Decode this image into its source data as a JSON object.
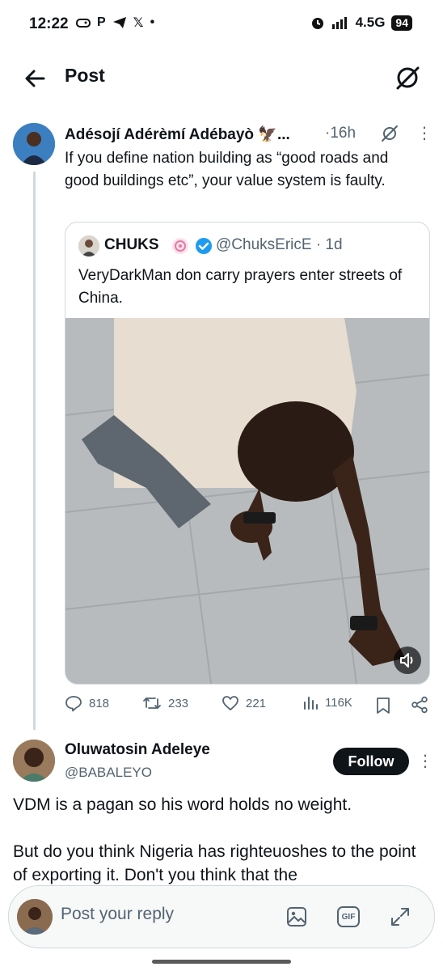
{
  "status_bar": {
    "time": "12:22",
    "network": "4.5G",
    "battery": "94"
  },
  "header": {
    "title": "Post"
  },
  "post": {
    "author": "Adésojí Adérèmí Adébayò 🦅...",
    "time": "·16h",
    "text": "If you define nation building as “good roads and good buildings etc”, your value system is faulty."
  },
  "quote": {
    "name": "CHUKS",
    "handle": "@ChuksEricE · 1d",
    "text": "VeryDarkMan don carry prayers enter streets of China."
  },
  "actions": {
    "replies": "818",
    "reposts": "233",
    "likes": "221",
    "views": "116K"
  },
  "reply": {
    "name": "Oluwatosin Adeleye",
    "handle": "@BABALEYO",
    "follow_label": "Follow",
    "paragraph1": "VDM is a pagan so his word holds no weight.",
    "paragraph2": "But do you think Nigeria has  righteuoshes to the point of exporting it. Don't you think that the"
  },
  "composer": {
    "placeholder": "Post your reply",
    "gif_label": "GIF"
  },
  "colors": {
    "text": "#0f1419",
    "secondary": "#536471",
    "border": "#cfd9de",
    "verified": "#1d9bf0"
  }
}
